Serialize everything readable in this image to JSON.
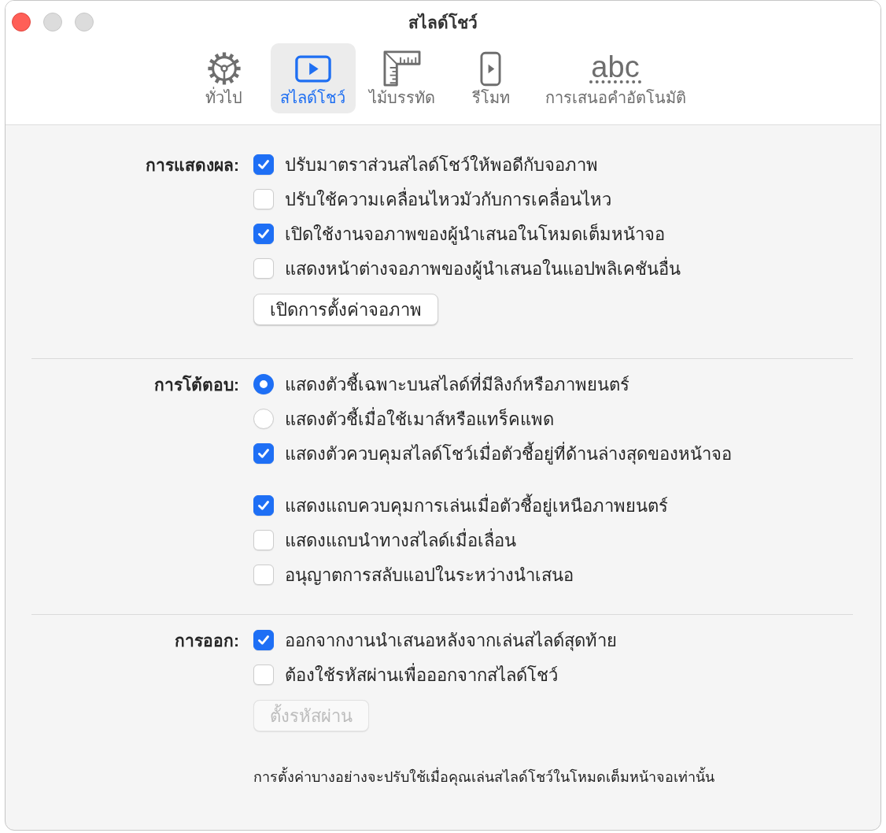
{
  "window": {
    "title": "สไลด์โชว์",
    "controls": [
      {
        "kind": "close",
        "disabled": false
      },
      {
        "kind": "minimize",
        "disabled": true
      },
      {
        "kind": "zoom",
        "disabled": true
      }
    ]
  },
  "tabs": [
    {
      "label": "ทั่วไป",
      "selected": false
    },
    {
      "label": "สไลด์โชว์",
      "selected": true
    },
    {
      "label": "ไม้บรรทัด",
      "selected": false
    },
    {
      "label": "รีโมท",
      "selected": false
    },
    {
      "icon_text": "abc",
      "label": "การเสนอคำอัตโนมัติ",
      "selected": false
    }
  ],
  "sections": [
    {
      "label": "การแสดงผล:",
      "groups": [
        {
          "items": [
            {
              "kind": "checkbox",
              "label": "ปรับมาตราส่วนสไลด์โชว์ให้พอดีกับจอภาพ",
              "checked": true
            },
            {
              "kind": "checkbox",
              "label": "ปรับใช้ความเคลื่อนไหวมัวกับการเคลื่อนไหว",
              "checked": false
            },
            {
              "kind": "checkbox",
              "label": "เปิดใช้งานจอภาพของผู้นำเสนอในโหมดเต็มหน้าจอ",
              "checked": true
            },
            {
              "kind": "checkbox",
              "label": "แสดงหน้าต่างจอภาพของผู้นำเสนอในแอปพลิเคชันอื่น",
              "checked": false
            },
            {
              "kind": "button",
              "label": "เปิดการตั้งค่าจอภาพ",
              "disabled": false
            }
          ]
        }
      ]
    },
    {
      "label": "การโต้ตอบ:",
      "groups": [
        {
          "items": [
            {
              "kind": "radio",
              "label": "แสดงตัวชี้เฉพาะบนสไลด์ที่มีลิงก์หรือภาพยนตร์",
              "selected": true
            },
            {
              "kind": "radio",
              "label": "แสดงตัวชี้เมื่อใช้เมาส์หรือแทร็คแพด",
              "selected": false
            },
            {
              "kind": "checkbox",
              "label": "แสดงตัวควบคุมสไลด์โชว์เมื่อตัวชี้อยู่ที่ด้านล่างสุดของหน้าจอ",
              "checked": true
            }
          ]
        },
        {
          "items": [
            {
              "kind": "checkbox",
              "label": "แสดงแถบควบคุมการเล่นเมื่อตัวชี้อยู่เหนือภาพยนตร์",
              "checked": true
            },
            {
              "kind": "checkbox",
              "label": "แสดงแถบนำทางสไลด์เมื่อเลื่อน",
              "checked": false
            },
            {
              "kind": "checkbox",
              "label": "อนุญาตการสลับแอปในระหว่างนำเสนอ",
              "checked": false
            }
          ]
        }
      ]
    },
    {
      "label": "การออก:",
      "groups": [
        {
          "items": [
            {
              "kind": "checkbox",
              "label": "ออกจากงานนำเสนอหลังจากเล่นสไลด์สุดท้าย",
              "checked": true
            },
            {
              "kind": "checkbox",
              "label": "ต้องใช้รหัสผ่านเพื่อออกจากสไลด์โชว์",
              "checked": false
            },
            {
              "kind": "button",
              "label": "ตั้งรหัสผ่าน",
              "disabled": true
            }
          ]
        }
      ]
    }
  ],
  "note": "การตั้งค่าบางอย่างจะปรับใช้เมื่อคุณเล่นสไลด์โชว์ในโหมดเต็มหน้าจอเท่านั้น"
}
